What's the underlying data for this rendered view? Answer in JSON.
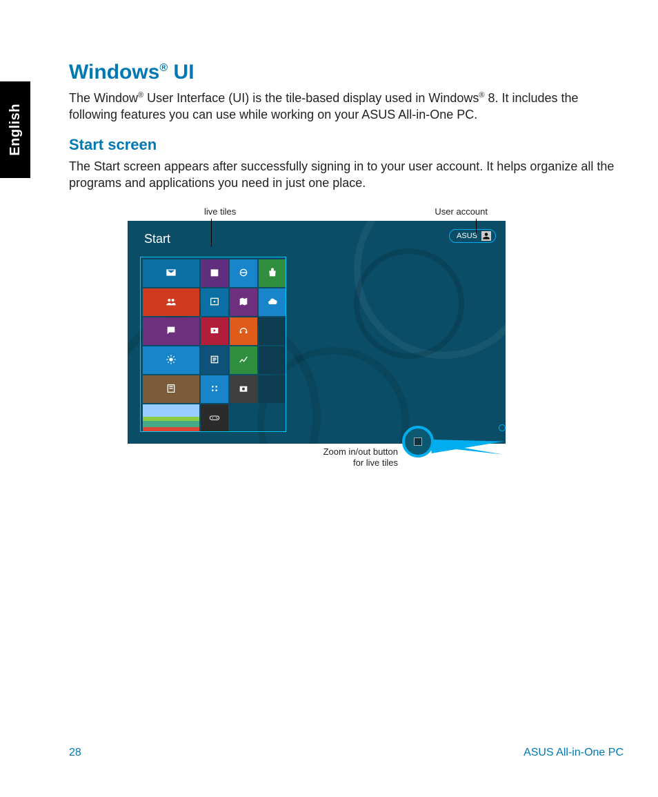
{
  "sideTab": "English",
  "heading": {
    "pre": "Windows",
    "sup": "®",
    "post": " UI"
  },
  "intro": {
    "pre": "The Window",
    "sup1": "®",
    "mid": " User Interface (UI) is the tile-based display used in Windows",
    "sup2": "®",
    "post": " 8. It includes the following features you can use while working on your ASUS All-in-One PC."
  },
  "subheading": "Start screen",
  "subtext": "The Start screen appears after  successfully signing in to your user account. It helps organize all the programs and applications you need in just one place.",
  "annotations": {
    "liveTiles": "live tiles",
    "userAccount": "User account",
    "zoomLine1": "Zoom in/out button",
    "zoomLine2": "for live tiles"
  },
  "startScreen": {
    "title": "Start",
    "userLabel": "ASUS"
  },
  "tiles": [
    {
      "name": "mail",
      "icon": "mail",
      "color": "#0b6fa4",
      "span": "wide"
    },
    {
      "name": "calendar",
      "icon": "calendar",
      "color": "#5f2e7d"
    },
    {
      "name": "ie",
      "icon": "ie",
      "color": "#1884c9"
    },
    {
      "name": "store",
      "icon": "store",
      "color": "#2f8f3e"
    },
    {
      "name": "people",
      "icon": "people",
      "color": "#cf3b1f",
      "span": "wide"
    },
    {
      "name": "photos",
      "icon": "photo",
      "color": "#0b6fa4"
    },
    {
      "name": "maps",
      "icon": "maps",
      "color": "#6d2f7e"
    },
    {
      "name": "skydrive",
      "icon": "cloud",
      "color": "#1884c9"
    },
    {
      "name": "messaging",
      "icon": "chat",
      "color": "#6d2f7e",
      "span": "wide"
    },
    {
      "name": "video",
      "icon": "video",
      "color": "#b01e3a"
    },
    {
      "name": "music",
      "icon": "headphones",
      "color": "#e05a1a"
    },
    {
      "name": "blank1",
      "icon": "",
      "color": "#0e3d52"
    },
    {
      "name": "weather",
      "icon": "weather",
      "color": "#1884c9",
      "span": "wide"
    },
    {
      "name": "news",
      "icon": "news",
      "color": "#0e527a"
    },
    {
      "name": "finance",
      "icon": "finance",
      "color": "#2f8f3e"
    },
    {
      "name": "blank2",
      "icon": "",
      "color": "#0e3d52"
    },
    {
      "name": "reader",
      "icon": "reader",
      "color": "#7a5c3a",
      "span": "wide"
    },
    {
      "name": "settings",
      "icon": "settings",
      "color": "#1884c9"
    },
    {
      "name": "camera",
      "icon": "camera",
      "color": "#3f3f3f"
    },
    {
      "name": "blank3",
      "icon": "",
      "color": "#0e3d52"
    },
    {
      "name": "photo-tile",
      "icon": "photoimg",
      "color": "#5a7a3a",
      "span": "wide"
    },
    {
      "name": "games",
      "icon": "games",
      "color": "#2b2b2b"
    }
  ],
  "footer": {
    "pageNumber": "28",
    "product": "ASUS All-in-One PC"
  }
}
